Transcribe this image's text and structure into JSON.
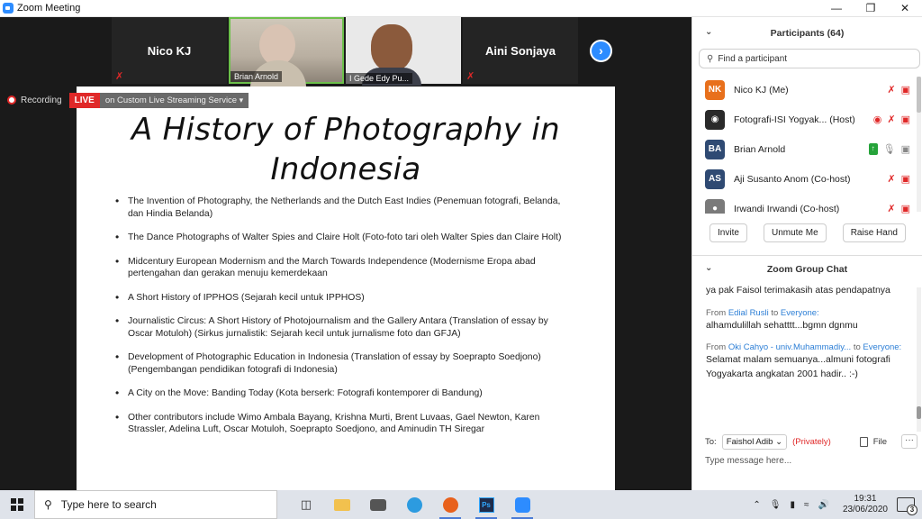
{
  "window": {
    "title": "Zoom Meeting"
  },
  "gallery": {
    "tiles": [
      {
        "name": "Nico KJ",
        "type": "name-only"
      },
      {
        "name": "Brian Arnold",
        "type": "video",
        "active": true
      },
      {
        "name": "I Gede Edy Pu...",
        "type": "video"
      },
      {
        "name": "Aini Sonjaya",
        "type": "name-only"
      }
    ],
    "next_icon": "chevron-right-icon"
  },
  "recording": {
    "label": "Recording",
    "live_label": "LIVE",
    "service": "on Custom Live Streaming Service"
  },
  "slide": {
    "title": "A History of Photography in Indonesia",
    "bullets": [
      "The Invention of Photography, the Netherlands and the Dutch East Indies (Penemuan fotografi, Belanda, dan Hindia Belanda)",
      "The Dance Photographs of Walter Spies and Claire Holt (Foto-foto tari oleh Walter Spies dan Claire Holt)",
      "Midcentury European Modernism and the March Towards Independence (Modernisme Eropa abad pertengahan dan gerakan menuju kemerdekaan",
      "A Short History of IPPHOS (Sejarah kecil untuk IPPHOS)",
      "Journalistic Circus: A Short History of Photojournalism and the Gallery Antara (Translation of essay by Oscar Motuloh) (Sirkus jurnalistik: Sejarah kecil untuk jurnalisme foto dan GFJA)",
      "Development of Photographic Education in Indonesia (Translation of essay by Soeprapto Soedjono) (Pengembangan pendidikan fotografi di Indonesia)",
      "A City on the Move: Banding Today (Kota berserk: Fotografi kontemporer di Bandung)",
      "Other contributors include Wimo Ambala Bayang, Krishna Murti, Brent Luvaas, Gael Newton, Karen Strassler, Adelina Luft, Oscar Motuloh, Soeprapto Soedjono, and Aminudin TH Siregar"
    ]
  },
  "participants": {
    "header": "Participants (64)",
    "search_placeholder": "Find a participant",
    "list": [
      {
        "initials": "NK",
        "color": "#e8701c",
        "name": "Nico KJ (Me)"
      },
      {
        "initials": "",
        "color": "#2a2a2a",
        "name": "Fotografi-ISI Yogyak... (Host)"
      },
      {
        "initials": "BA",
        "color": "#2f4a73",
        "name": "Brian Arnold"
      },
      {
        "initials": "AS",
        "color": "#2f4a73",
        "name": "Aji Susanto Anom (Co-host)"
      },
      {
        "initials": "",
        "color": "#7a7a7a",
        "name": "Irwandi Irwandi (Co-host)"
      }
    ],
    "buttons": {
      "invite": "Invite",
      "unmute": "Unmute Me",
      "raise": "Raise Hand"
    }
  },
  "chat": {
    "header": "Zoom Group Chat",
    "messages": [
      {
        "text": "ya pak Faisol terimakasih atas pendapatnya"
      },
      {
        "from_prefix": "From",
        "from": "Edial Rusli",
        "to_word": "to",
        "to": "Everyone:",
        "text": "alhamdulillah sehatttt...bgmn dgnmu"
      },
      {
        "from_prefix": "From",
        "from": "Oki Cahyo - univ.Muhammadiy...",
        "to_word": "to",
        "to": "Everyone:",
        "text": "Selamat malam semuanya...almuni fotografi Yogyakarta angkatan 2001 hadir.. :-)"
      }
    ],
    "to_label": "To:",
    "to_value": "Faishol Adib",
    "privately": "(Privately)",
    "file_label": "File",
    "more_label": "···",
    "input_placeholder": "Type message here..."
  },
  "taskbar": {
    "search_placeholder": "Type here to search",
    "time": "19:31",
    "date": "23/06/2020",
    "notifications": "3"
  }
}
